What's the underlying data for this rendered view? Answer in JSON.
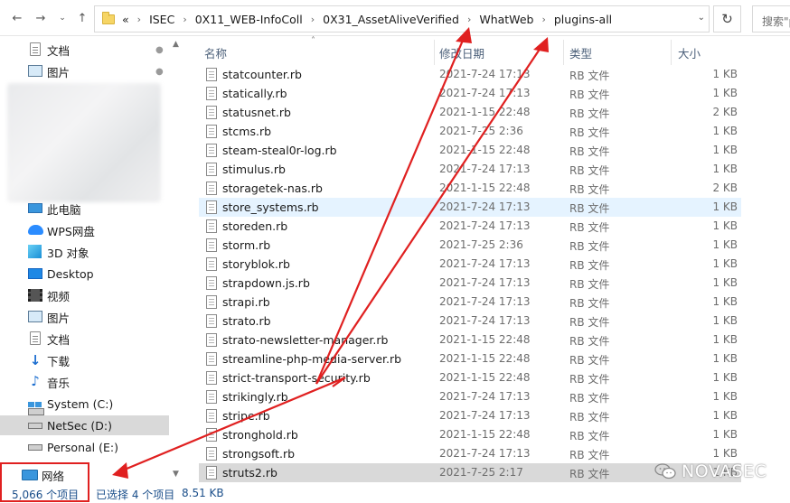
{
  "address": {
    "breadcrumbs": [
      "ISEC",
      "0X11_WEB-InfoColl",
      "0X31_AssetAliveVerified",
      "WhatWeb",
      "plugins-all"
    ],
    "overflow_glyph": "«",
    "search_placeholder": "搜索\"p"
  },
  "sidebar": {
    "quick_access": [
      {
        "label": "文档",
        "icon": "document-icon",
        "pinned": true
      },
      {
        "label": "图片",
        "icon": "picture-icon",
        "pinned": true
      }
    ],
    "this_pc_label": "此电脑",
    "items": [
      {
        "label": "WPS网盘",
        "icon": "cloud-icon"
      },
      {
        "label": "3D 对象",
        "icon": "3d-objects-icon"
      },
      {
        "label": "Desktop",
        "icon": "desktop-icon"
      },
      {
        "label": "视频",
        "icon": "video-icon"
      },
      {
        "label": "图片",
        "icon": "picture-icon"
      },
      {
        "label": "文档",
        "icon": "document-icon"
      },
      {
        "label": "下载",
        "icon": "download-icon"
      },
      {
        "label": "音乐",
        "icon": "music-icon"
      },
      {
        "label": "System (C:)",
        "icon": "windows-drive-icon"
      },
      {
        "label": "NetSec (D:)",
        "icon": "drive-icon"
      },
      {
        "label": "Personal (E:)",
        "icon": "drive-icon"
      }
    ],
    "network_label": "网络"
  },
  "columns": {
    "name": "名称",
    "date": "修改日期",
    "type": "类型",
    "size": "大小"
  },
  "files": [
    {
      "name": "statcounter.rb",
      "date": "2021-7-24 17:13",
      "type": "RB 文件",
      "size": "1 KB"
    },
    {
      "name": "statically.rb",
      "date": "2021-7-24 17:13",
      "type": "RB 文件",
      "size": "1 KB"
    },
    {
      "name": "statusnet.rb",
      "date": "2021-1-15 22:48",
      "type": "RB 文件",
      "size": "2 KB"
    },
    {
      "name": "stcms.rb",
      "date": "2021-7-25 2:36",
      "type": "RB 文件",
      "size": "1 KB"
    },
    {
      "name": "steam-steal0r-log.rb",
      "date": "2021-1-15 22:48",
      "type": "RB 文件",
      "size": "1 KB"
    },
    {
      "name": "stimulus.rb",
      "date": "2021-7-24 17:13",
      "type": "RB 文件",
      "size": "1 KB"
    },
    {
      "name": "storagetek-nas.rb",
      "date": "2021-1-15 22:48",
      "type": "RB 文件",
      "size": "2 KB"
    },
    {
      "name": "store_systems.rb",
      "date": "2021-7-24 17:13",
      "type": "RB 文件",
      "size": "1 KB"
    },
    {
      "name": "storeden.rb",
      "date": "2021-7-24 17:13",
      "type": "RB 文件",
      "size": "1 KB"
    },
    {
      "name": "storm.rb",
      "date": "2021-7-25 2:36",
      "type": "RB 文件",
      "size": "1 KB"
    },
    {
      "name": "storyblok.rb",
      "date": "2021-7-24 17:13",
      "type": "RB 文件",
      "size": "1 KB"
    },
    {
      "name": "strapdown.js.rb",
      "date": "2021-7-24 17:13",
      "type": "RB 文件",
      "size": "1 KB"
    },
    {
      "name": "strapi.rb",
      "date": "2021-7-24 17:13",
      "type": "RB 文件",
      "size": "1 KB"
    },
    {
      "name": "strato.rb",
      "date": "2021-7-24 17:13",
      "type": "RB 文件",
      "size": "1 KB"
    },
    {
      "name": "strato-newsletter-manager.rb",
      "date": "2021-1-15 22:48",
      "type": "RB 文件",
      "size": "1 KB"
    },
    {
      "name": "streamline-php-media-server.rb",
      "date": "2021-1-15 22:48",
      "type": "RB 文件",
      "size": "1 KB"
    },
    {
      "name": "strict-transport-security.rb",
      "date": "2021-1-15 22:48",
      "type": "RB 文件",
      "size": "1 KB"
    },
    {
      "name": "strikingly.rb",
      "date": "2021-7-24 17:13",
      "type": "RB 文件",
      "size": "1 KB"
    },
    {
      "name": "stripe.rb",
      "date": "2021-7-24 17:13",
      "type": "RB 文件",
      "size": "1 KB"
    },
    {
      "name": "stronghold.rb",
      "date": "2021-1-15 22:48",
      "type": "RB 文件",
      "size": "1 KB"
    },
    {
      "name": "strongsoft.rb",
      "date": "2021-7-24 17:13",
      "type": "RB 文件",
      "size": "1 KB"
    },
    {
      "name": "struts2.rb",
      "date": "2021-7-25 2:17",
      "type": "RB 文件",
      "size": "1 KB"
    }
  ],
  "status": {
    "item_count": "5,066 个项目",
    "selection": "已选择 4 个项目",
    "selection_size": "8.51 KB"
  },
  "watermark": "NOVASEC",
  "colors": {
    "annotation_red": "#e02020",
    "selection_blue": "#cce4f7",
    "status_text": "#1a4e8a"
  }
}
